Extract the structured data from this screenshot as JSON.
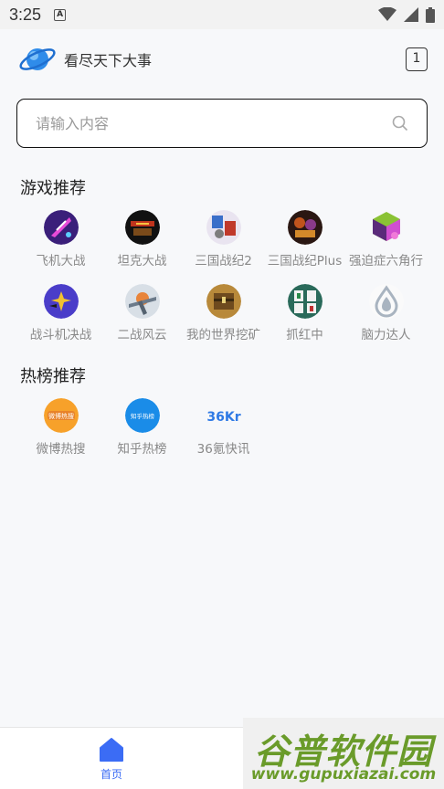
{
  "status_bar": {
    "time": "3:25",
    "notification_icon": "a-icon",
    "wifi_icon": "wifi-icon",
    "signal_icon": "signal-icon",
    "battery_icon": "battery-icon"
  },
  "header": {
    "title": "看尽天下大事",
    "tab_count": "1"
  },
  "search": {
    "placeholder": "请输入内容"
  },
  "games": {
    "title": "游戏推荐",
    "items": [
      {
        "label": "飞机大战"
      },
      {
        "label": "坦克大战"
      },
      {
        "label": "三国战纪2"
      },
      {
        "label": "三国战纪Plus"
      },
      {
        "label": "强迫症六角行"
      },
      {
        "label": "战斗机决战"
      },
      {
        "label": "二战风云"
      },
      {
        "label": "我的世界挖矿"
      },
      {
        "label": "抓红中"
      },
      {
        "label": "脑力达人"
      }
    ]
  },
  "hot": {
    "title": "热榜推荐",
    "items": [
      {
        "label": "微博热搜",
        "icon_text": "微博热搜"
      },
      {
        "label": "知乎热榜",
        "icon_text": "知乎热榜"
      },
      {
        "label": "36氪快讯",
        "icon_text": "36Kr"
      }
    ]
  },
  "nav": {
    "home_label": "首页"
  },
  "watermark": {
    "title": "谷普软件园",
    "url": "www.gupuxiazai.com"
  },
  "colors": {
    "accent": "#3b6cf5",
    "watermark_green": "#6a9b2a"
  }
}
